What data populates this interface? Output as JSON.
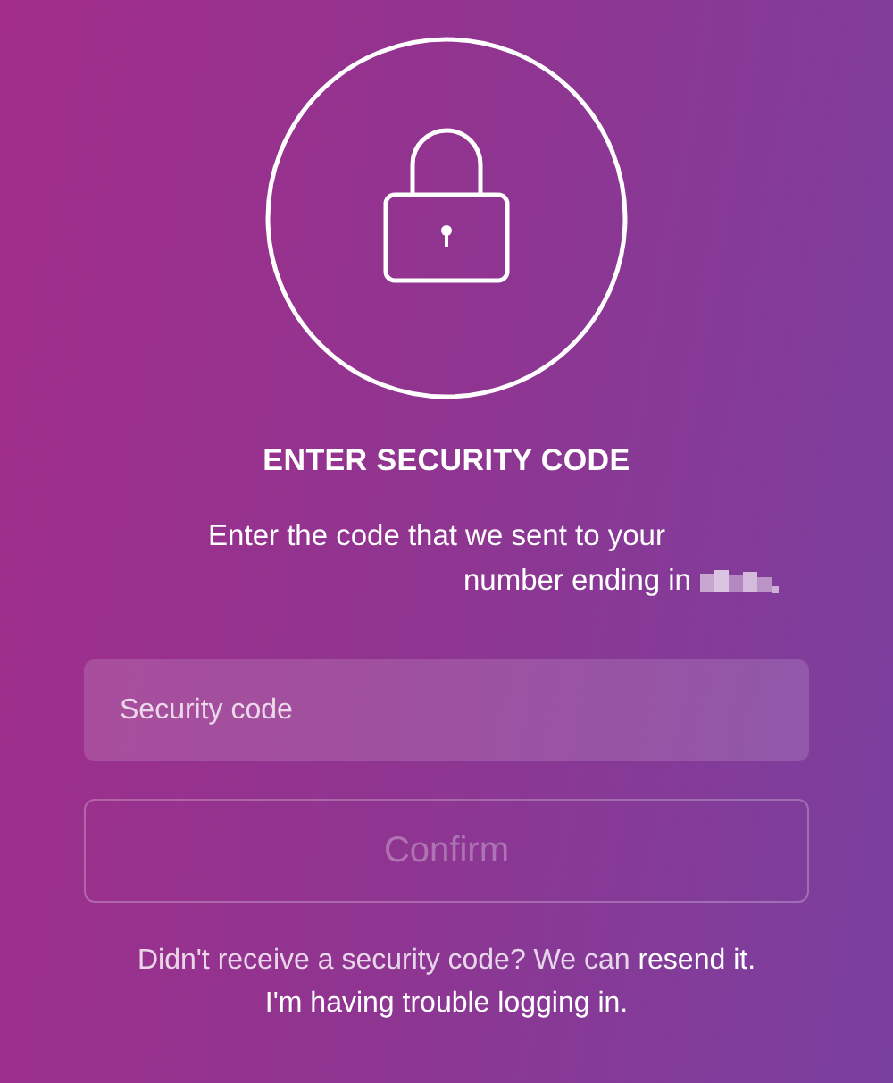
{
  "title": "ENTER SECURITY CODE",
  "instruction": "Enter the code that we sent to your number ending in",
  "code_field": {
    "placeholder": "Security code"
  },
  "confirm_button": {
    "label": "Confirm",
    "disabled": true
  },
  "resend": {
    "text": "Didn't receive a security code? We can",
    "link": "resend it."
  },
  "help_link": "I'm having trouble logging in."
}
